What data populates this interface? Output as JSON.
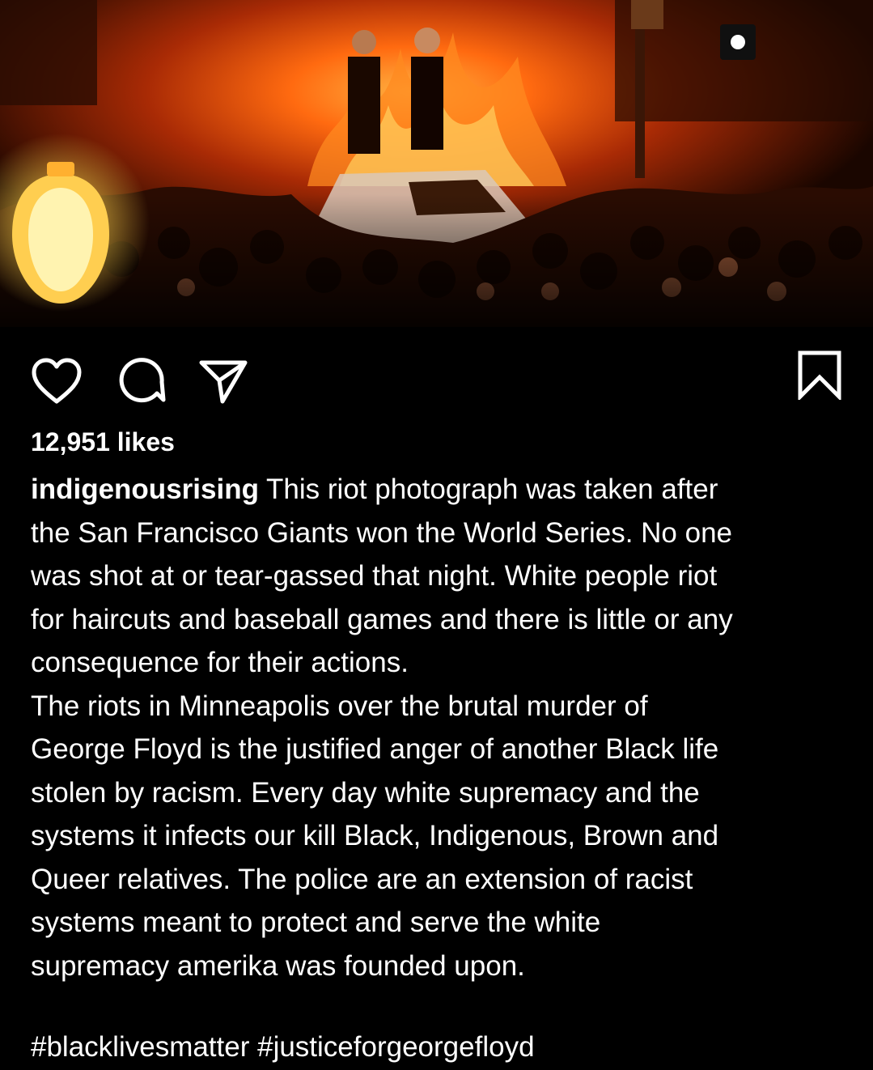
{
  "post": {
    "image": {
      "icon": "riot-fire-photo",
      "colors": {
        "fire": "#ff6a10",
        "shadow": "#1a0600",
        "lamp": "#ffd24a"
      }
    },
    "actions": {
      "like_icon": "heart-icon",
      "comment_icon": "comment-icon",
      "share_icon": "send-icon",
      "save_icon": "bookmark-icon",
      "icon_color": "#ffffff"
    },
    "likes": "12,951 likes",
    "caption": {
      "username": "indigenousrising",
      "lines": [
        "This riot photograph was taken after",
        "the San Francisco Giants won the World Series. No one",
        "was shot at or tear-gassed that night. White people riot",
        "for haircuts and baseball games and there is little or any",
        "consequence for their actions.",
        "The riots in Minneapolis over the brutal murder of",
        "George Floyd is the justified anger of another Black life",
        "stolen by racism. Every day white supremacy and the",
        "systems it infects our kill Black, Indigenous, Brown and",
        "Queer relatives. The police are an extension of racist",
        "systems meant to protect and serve the white",
        "supremacy amerika was founded upon."
      ],
      "hashtags": "#blacklivesmatter #justiceforgeorgefloyd"
    }
  }
}
